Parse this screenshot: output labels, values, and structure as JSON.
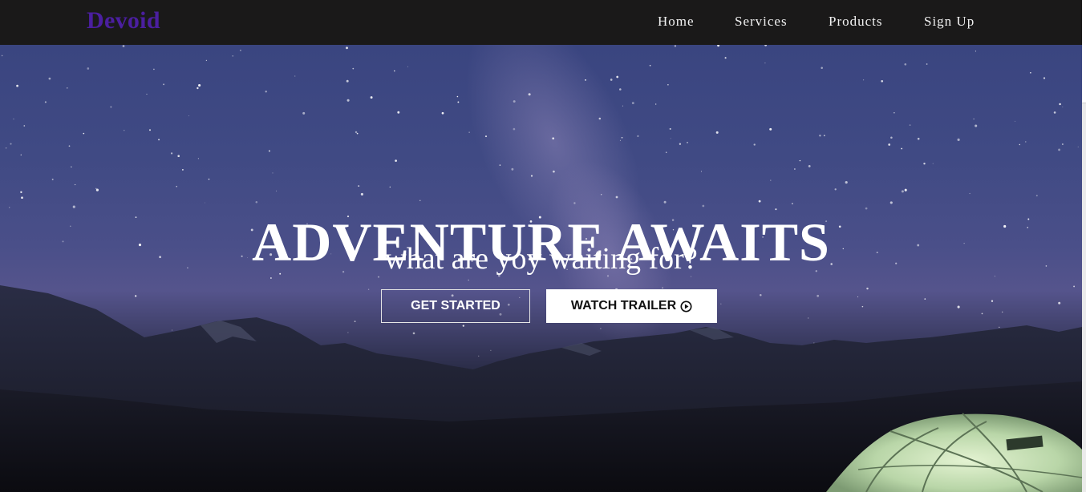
{
  "navbar": {
    "logo": "Devoid",
    "links": [
      {
        "label": "Home"
      },
      {
        "label": "Services"
      },
      {
        "label": "Products"
      },
      {
        "label": "Sign Up"
      }
    ]
  },
  "hero": {
    "title": "ADVENTURE AWAITS",
    "subtitle": "what are yoy waiting for?",
    "buttons": {
      "get_started": "GET STARTED",
      "watch_trailer": "WATCH TRAILER",
      "watch_trailer_icon": "play-circle-icon"
    },
    "background": "night-sky-mountains-tent-image"
  },
  "colors": {
    "navbar_bg": "#1a1919",
    "logo": "#4b1fa0",
    "nav_text": "#f2f2f2",
    "hero_text": "#ffffff"
  }
}
